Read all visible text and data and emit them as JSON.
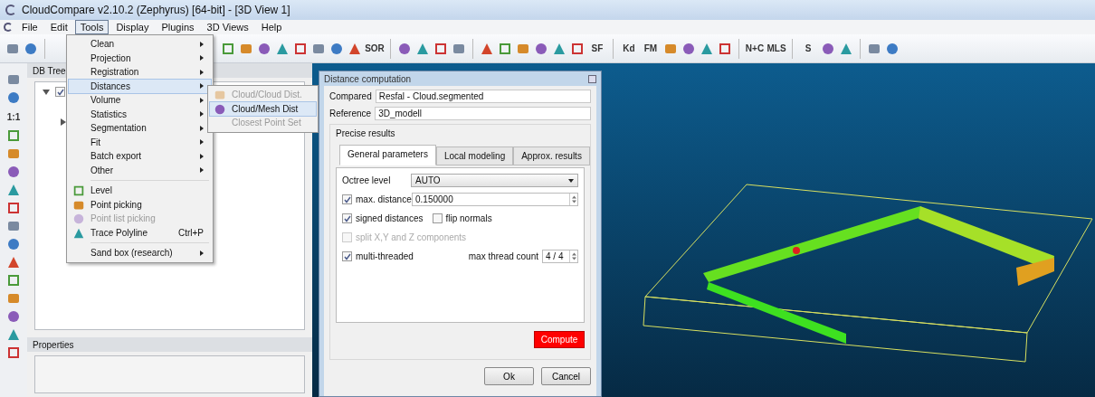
{
  "window": {
    "title": "CloudCompare v2.10.2 (Zephyrus) [64-bit] - [3D View 1]"
  },
  "menu_bar": [
    {
      "label": "File",
      "selected": false
    },
    {
      "label": "Edit",
      "selected": false
    },
    {
      "label": "Tools",
      "selected": true
    },
    {
      "label": "Display",
      "selected": false
    },
    {
      "label": "Plugins",
      "selected": false
    },
    {
      "label": "3D Views",
      "selected": false
    },
    {
      "label": "Help",
      "selected": false
    }
  ],
  "toolbar": [
    {
      "kind": "icon"
    },
    {
      "kind": "icon"
    },
    {
      "kind": "sep"
    },
    {
      "kind": "icon"
    },
    {
      "kind": "icon"
    },
    {
      "kind": "icon"
    },
    {
      "kind": "icon"
    },
    {
      "kind": "icon"
    },
    {
      "kind": "icon"
    },
    {
      "kind": "icon"
    },
    {
      "kind": "icon"
    },
    {
      "kind": "text",
      "label": "SOR"
    },
    {
      "kind": "sep"
    },
    {
      "kind": "icon"
    },
    {
      "kind": "icon"
    },
    {
      "kind": "icon"
    },
    {
      "kind": "icon"
    },
    {
      "kind": "sep"
    },
    {
      "kind": "icon"
    },
    {
      "kind": "icon"
    },
    {
      "kind": "icon"
    },
    {
      "kind": "icon"
    },
    {
      "kind": "icon"
    },
    {
      "kind": "icon"
    },
    {
      "kind": "text",
      "label": "SF"
    },
    {
      "kind": "sep"
    },
    {
      "kind": "text",
      "label": "Kd"
    },
    {
      "kind": "text",
      "label": "FM"
    },
    {
      "kind": "icon"
    },
    {
      "kind": "icon"
    },
    {
      "kind": "icon"
    },
    {
      "kind": "icon"
    },
    {
      "kind": "sep"
    },
    {
      "kind": "text",
      "label": "N+C"
    },
    {
      "kind": "text",
      "label": "MLS"
    },
    {
      "kind": "sep"
    },
    {
      "kind": "text",
      "label": "S"
    },
    {
      "kind": "icon"
    },
    {
      "kind": "icon"
    },
    {
      "kind": "sep"
    },
    {
      "kind": "icon"
    },
    {
      "kind": "icon"
    }
  ],
  "side_toolbar": [
    {
      "kind": "icon"
    },
    {
      "kind": "icon"
    },
    {
      "kind": "text",
      "label": "1:1"
    },
    {
      "kind": "icon"
    },
    {
      "kind": "icon"
    },
    {
      "kind": "icon"
    },
    {
      "kind": "icon"
    },
    {
      "kind": "icon"
    },
    {
      "kind": "icon"
    },
    {
      "kind": "icon"
    },
    {
      "kind": "icon"
    },
    {
      "kind": "icon"
    },
    {
      "kind": "icon"
    },
    {
      "kind": "icon"
    },
    {
      "kind": "icon"
    },
    {
      "kind": "icon"
    }
  ],
  "db_tree": {
    "title": "DB Tree",
    "items": [
      {
        "expanded": true,
        "checked": true,
        "children": [
          {
            "expanded": false
          }
        ]
      }
    ]
  },
  "properties": {
    "title": "Properties"
  },
  "tools_menu": [
    {
      "kind": "item",
      "label": "Clean",
      "submenu": true,
      "selected": false,
      "disabled": false
    },
    {
      "kind": "item",
      "label": "Projection",
      "submenu": true,
      "selected": false,
      "disabled": false
    },
    {
      "kind": "item",
      "label": "Registration",
      "submenu": true,
      "selected": false,
      "disabled": false
    },
    {
      "kind": "item",
      "label": "Distances",
      "submenu": true,
      "selected": true,
      "disabled": false
    },
    {
      "kind": "item",
      "label": "Volume",
      "submenu": true,
      "selected": false,
      "disabled": false
    },
    {
      "kind": "item",
      "label": "Statistics",
      "submenu": true,
      "selected": false,
      "disabled": false
    },
    {
      "kind": "item",
      "label": "Segmentation",
      "submenu": true,
      "selected": false,
      "disabled": false
    },
    {
      "kind": "item",
      "label": "Fit",
      "submenu": true,
      "selected": false,
      "disabled": false
    },
    {
      "kind": "item",
      "label": "Batch export",
      "submenu": true,
      "selected": false,
      "disabled": false
    },
    {
      "kind": "item",
      "label": "Other",
      "submenu": true,
      "selected": false,
      "disabled": false
    },
    {
      "kind": "sep"
    },
    {
      "kind": "item",
      "label": "Level",
      "icon": true,
      "selected": false,
      "disabled": false
    },
    {
      "kind": "item",
      "label": "Point picking",
      "icon": true,
      "selected": false,
      "disabled": false
    },
    {
      "kind": "item",
      "label": "Point list picking",
      "icon": true,
      "selected": false,
      "disabled": true
    },
    {
      "kind": "item",
      "label": "Trace Polyline",
      "icon": true,
      "shortcut": "Ctrl+P",
      "selected": false,
      "disabled": false
    },
    {
      "kind": "sep"
    },
    {
      "kind": "item",
      "label": "Sand box (research)",
      "submenu": true,
      "selected": false,
      "disabled": false
    }
  ],
  "distances_submenu": [
    {
      "label": "Cloud/Cloud Dist.",
      "selected": false,
      "disabled": true
    },
    {
      "label": "Cloud/Mesh Dist",
      "selected": true,
      "disabled": false
    },
    {
      "label": "Closest Point Set",
      "selected": false,
      "disabled": true
    }
  ],
  "dialog": {
    "title": "Distance computation",
    "compared_label": "Compared",
    "compared": "Resfal - Cloud.segmented",
    "reference_label": "Reference",
    "reference": "3D_modell",
    "group_title": "Precise results",
    "tabs": [
      {
        "label": "General parameters",
        "selected": true
      },
      {
        "label": "Local modeling",
        "selected": false
      },
      {
        "label": "Approx. results",
        "selected": false
      }
    ],
    "octree_label": "Octree level",
    "octree_value": "AUTO",
    "max_distance": {
      "label": "max. distance",
      "checked": true,
      "value": "0.150000"
    },
    "signed_distances": {
      "label": "signed distances",
      "checked": true
    },
    "flip_normals": {
      "label": "flip normals",
      "checked": false
    },
    "split": {
      "label": "split X,Y and Z components",
      "checked": false,
      "disabled": true
    },
    "multi_threaded": {
      "label": "multi-threaded",
      "checked": true
    },
    "thread_label": "max thread count",
    "thread_value": "4 / 4",
    "compute": "Compute",
    "ok": "Ok",
    "cancel": "Cancel"
  }
}
